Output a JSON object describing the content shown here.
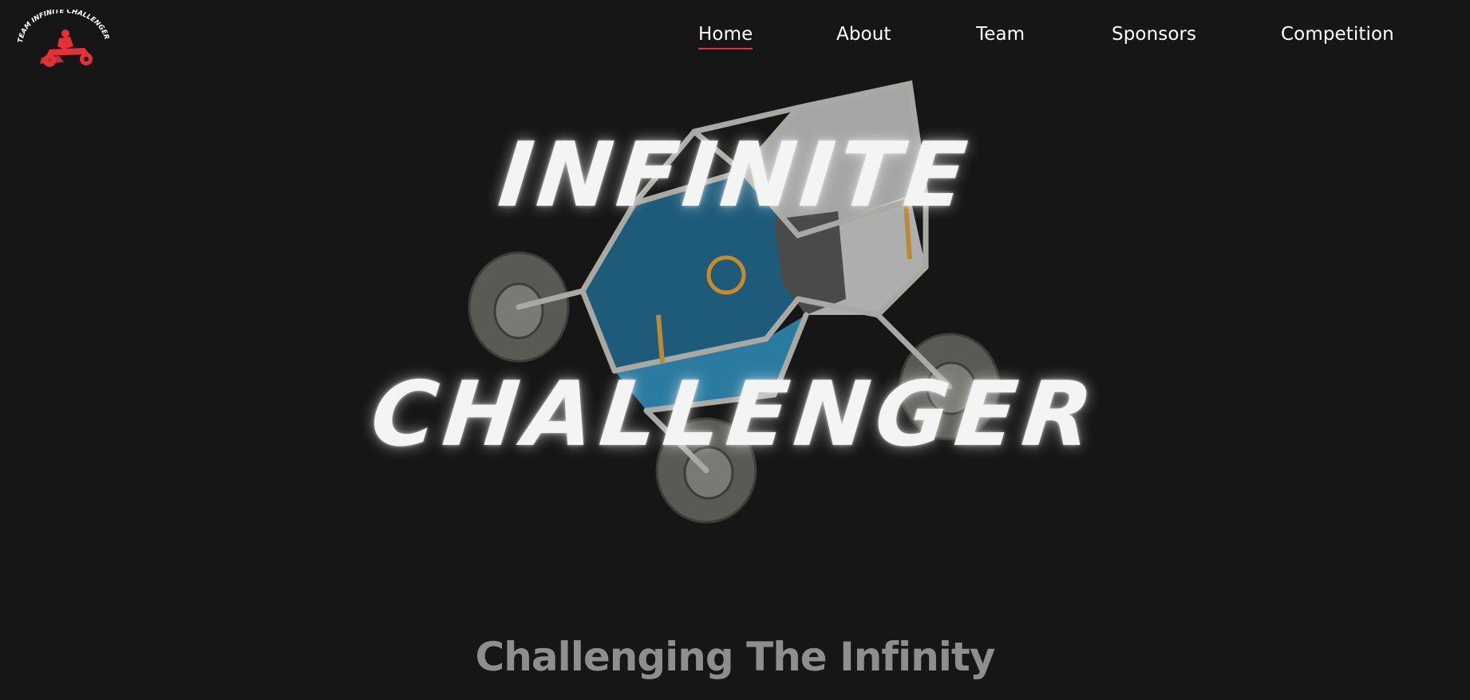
{
  "logo": {
    "text": "TEAM INFINITE CHALLENGER",
    "icon": "atv-rider-logo",
    "color": "#e5303a"
  },
  "nav": {
    "items": [
      {
        "label": "Home",
        "active": true
      },
      {
        "label": "About",
        "active": false
      },
      {
        "label": "Team",
        "active": false
      },
      {
        "label": "Sponsors",
        "active": false
      },
      {
        "label": "Competition",
        "active": false
      }
    ],
    "active_underline_color": "#e5303a"
  },
  "hero": {
    "line1": "INFINITE",
    "line2": "CHALLENGER",
    "image": "baja-buggy-render"
  },
  "tagline": "Challenging The Infinity",
  "colors": {
    "background": "#161616",
    "text": "#ffffff",
    "tagline": "#8e8e8e",
    "accent": "#e5303a"
  }
}
